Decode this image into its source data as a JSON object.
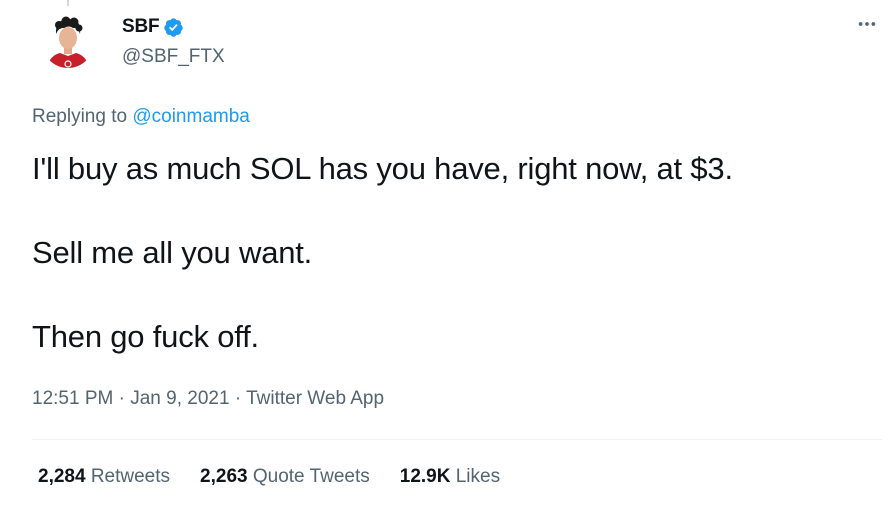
{
  "colors": {
    "accent": "#1d9bf0",
    "text_primary": "#0f1419",
    "text_secondary": "#536471",
    "divider": "#eff3f4"
  },
  "author": {
    "name": "SBF",
    "handle": "@SBF_FTX",
    "verified": true,
    "avatar_icon": "profile-photo"
  },
  "more_icon": "more-horizontal-icon",
  "reply": {
    "prefix": "Replying to",
    "mention": "@coinmamba"
  },
  "tweet": {
    "lines": [
      "I'll buy as much SOL has you have, right now, at $3.",
      "Sell me all you want.",
      "Then go fuck off."
    ]
  },
  "meta": {
    "time": "12:51 PM",
    "date": "Jan 9, 2021",
    "source": "Twitter Web App",
    "separator": "·"
  },
  "stats": {
    "retweets_count": "2,284",
    "retweets_label": "Retweets",
    "quotes_count": "2,263",
    "quotes_label": "Quote Tweets",
    "likes_count": "12.9K",
    "likes_label": "Likes"
  }
}
